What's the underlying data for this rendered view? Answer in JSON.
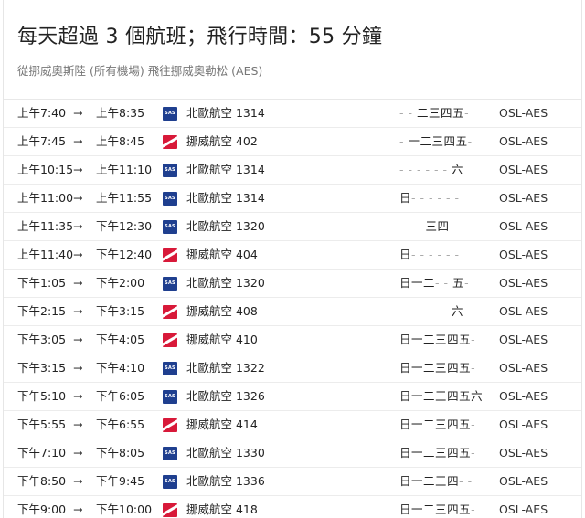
{
  "header": {
    "title": "每天超過 3 個航班；飛行時間：55 分鐘",
    "subtitle": "從挪威奧斯陸 (所有機場) 飛往挪威奧勒松 (AES)"
  },
  "arrow_glyph": "→",
  "flights": [
    {
      "dep": "上午7:40",
      "arr": "上午8:35",
      "airline": "sas",
      "airline_icon": "sas-logo-icon",
      "flight": "北歐航空 1314",
      "days": [
        "-",
        "-",
        "二",
        "三",
        "四",
        "五",
        "-"
      ],
      "route": "OSL-AES"
    },
    {
      "dep": "上午7:45",
      "arr": "上午8:45",
      "airline": "nor",
      "airline_icon": "norwegian-logo-icon",
      "flight": "挪威航空 402",
      "days": [
        "-",
        "一",
        "二",
        "三",
        "四",
        "五",
        "-"
      ],
      "route": "OSL-AES"
    },
    {
      "dep": "上午10:15",
      "arr": "上午11:10",
      "airline": "sas",
      "airline_icon": "sas-logo-icon",
      "flight": "北歐航空 1314",
      "days": [
        "-",
        "-",
        "-",
        "-",
        "-",
        "-",
        "六"
      ],
      "route": "OSL-AES"
    },
    {
      "dep": "上午11:00",
      "arr": "上午11:55",
      "airline": "sas",
      "airline_icon": "sas-logo-icon",
      "flight": "北歐航空 1314",
      "days": [
        "日",
        "-",
        "-",
        "-",
        "-",
        "-",
        "-"
      ],
      "route": "OSL-AES"
    },
    {
      "dep": "上午11:35",
      "arr": "下午12:30",
      "airline": "sas",
      "airline_icon": "sas-logo-icon",
      "flight": "北歐航空 1320",
      "days": [
        "-",
        "-",
        "-",
        "三",
        "四",
        "-",
        "-"
      ],
      "route": "OSL-AES"
    },
    {
      "dep": "上午11:40",
      "arr": "下午12:40",
      "airline": "nor",
      "airline_icon": "norwegian-logo-icon",
      "flight": "挪威航空 404",
      "days": [
        "日",
        "-",
        "-",
        "-",
        "-",
        "-",
        "-"
      ],
      "route": "OSL-AES"
    },
    {
      "dep": "下午1:05",
      "arr": "下午2:00",
      "airline": "sas",
      "airline_icon": "sas-logo-icon",
      "flight": "北歐航空 1320",
      "days": [
        "日",
        "一",
        "二",
        "-",
        "-",
        "五",
        "-"
      ],
      "route": "OSL-AES"
    },
    {
      "dep": "下午2:15",
      "arr": "下午3:15",
      "airline": "nor",
      "airline_icon": "norwegian-logo-icon",
      "flight": "挪威航空 408",
      "days": [
        "-",
        "-",
        "-",
        "-",
        "-",
        "-",
        "六"
      ],
      "route": "OSL-AES"
    },
    {
      "dep": "下午3:05",
      "arr": "下午4:05",
      "airline": "nor",
      "airline_icon": "norwegian-logo-icon",
      "flight": "挪威航空 410",
      "days": [
        "日",
        "一",
        "二",
        "三",
        "四",
        "五",
        "-"
      ],
      "route": "OSL-AES"
    },
    {
      "dep": "下午3:15",
      "arr": "下午4:10",
      "airline": "sas",
      "airline_icon": "sas-logo-icon",
      "flight": "北歐航空 1322",
      "days": [
        "日",
        "一",
        "二",
        "三",
        "四",
        "五",
        "-"
      ],
      "route": "OSL-AES"
    },
    {
      "dep": "下午5:10",
      "arr": "下午6:05",
      "airline": "sas",
      "airline_icon": "sas-logo-icon",
      "flight": "北歐航空 1326",
      "days": [
        "日",
        "一",
        "二",
        "三",
        "四",
        "五",
        "六"
      ],
      "route": "OSL-AES"
    },
    {
      "dep": "下午5:55",
      "arr": "下午6:55",
      "airline": "nor",
      "airline_icon": "norwegian-logo-icon",
      "flight": "挪威航空 414",
      "days": [
        "日",
        "一",
        "二",
        "三",
        "四",
        "五",
        "-"
      ],
      "route": "OSL-AES"
    },
    {
      "dep": "下午7:10",
      "arr": "下午8:05",
      "airline": "sas",
      "airline_icon": "sas-logo-icon",
      "flight": "北歐航空 1330",
      "days": [
        "日",
        "一",
        "二",
        "三",
        "四",
        "五",
        "-"
      ],
      "route": "OSL-AES"
    },
    {
      "dep": "下午8:50",
      "arr": "下午9:45",
      "airline": "sas",
      "airline_icon": "sas-logo-icon",
      "flight": "北歐航空 1336",
      "days": [
        "日",
        "一",
        "二",
        "三",
        "四",
        "-",
        "-"
      ],
      "route": "OSL-AES"
    },
    {
      "dep": "下午9:00",
      "arr": "下午10:00",
      "airline": "nor",
      "airline_icon": "norwegian-logo-icon",
      "flight": "挪威航空 418",
      "days": [
        "日",
        "一",
        "二",
        "三",
        "四",
        "五",
        "-"
      ],
      "route": "OSL-AES"
    }
  ]
}
